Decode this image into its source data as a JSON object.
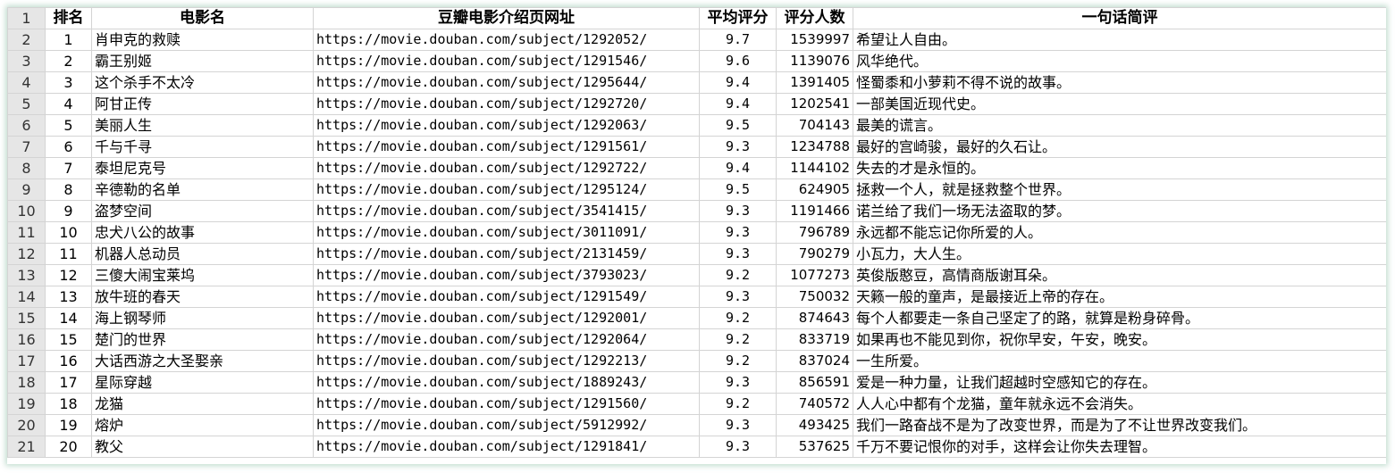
{
  "header": {
    "row_number": "1",
    "rank": "排名",
    "title": "电影名",
    "url": "豆瓣电影介绍页网址",
    "score": "平均评分",
    "count": "评分人数",
    "quote": "一句话简评"
  },
  "rows": [
    {
      "n": "2",
      "rank": "1",
      "title": "肖申克的救赎",
      "url": "https://movie.douban.com/subject/1292052/",
      "score": "9.7",
      "count": "1539997",
      "quote": "希望让人自由。"
    },
    {
      "n": "3",
      "rank": "2",
      "title": "霸王别姬",
      "url": "https://movie.douban.com/subject/1291546/",
      "score": "9.6",
      "count": "1139076",
      "quote": "风华绝代。"
    },
    {
      "n": "4",
      "rank": "3",
      "title": "这个杀手不太冷",
      "url": "https://movie.douban.com/subject/1295644/",
      "score": "9.4",
      "count": "1391405",
      "quote": "怪蜀黍和小萝莉不得不说的故事。"
    },
    {
      "n": "5",
      "rank": "4",
      "title": "阿甘正传",
      "url": "https://movie.douban.com/subject/1292720/",
      "score": "9.4",
      "count": "1202541",
      "quote": "一部美国近现代史。"
    },
    {
      "n": "6",
      "rank": "5",
      "title": "美丽人生",
      "url": "https://movie.douban.com/subject/1292063/",
      "score": "9.5",
      "count": "704143",
      "quote": "最美的谎言。"
    },
    {
      "n": "7",
      "rank": "6",
      "title": "千与千寻",
      "url": "https://movie.douban.com/subject/1291561/",
      "score": "9.3",
      "count": "1234788",
      "quote": "最好的宫崎骏，最好的久石让。"
    },
    {
      "n": "8",
      "rank": "7",
      "title": "泰坦尼克号",
      "url": "https://movie.douban.com/subject/1292722/",
      "score": "9.4",
      "count": "1144102",
      "quote": "失去的才是永恒的。"
    },
    {
      "n": "9",
      "rank": "8",
      "title": "辛德勒的名单",
      "url": "https://movie.douban.com/subject/1295124/",
      "score": "9.5",
      "count": "624905",
      "quote": "拯救一个人，就是拯救整个世界。"
    },
    {
      "n": "10",
      "rank": "9",
      "title": "盗梦空间",
      "url": "https://movie.douban.com/subject/3541415/",
      "score": "9.3",
      "count": "1191466",
      "quote": "诺兰给了我们一场无法盗取的梦。"
    },
    {
      "n": "11",
      "rank": "10",
      "title": "忠犬八公的故事",
      "url": "https://movie.douban.com/subject/3011091/",
      "score": "9.3",
      "count": "796789",
      "quote": "永远都不能忘记你所爱的人。"
    },
    {
      "n": "12",
      "rank": "11",
      "title": "机器人总动员",
      "url": "https://movie.douban.com/subject/2131459/",
      "score": "9.3",
      "count": "790279",
      "quote": "小瓦力，大人生。"
    },
    {
      "n": "13",
      "rank": "12",
      "title": "三傻大闹宝莱坞",
      "url": "https://movie.douban.com/subject/3793023/",
      "score": "9.2",
      "count": "1077273",
      "quote": "英俊版憨豆，高情商版谢耳朵。"
    },
    {
      "n": "14",
      "rank": "13",
      "title": "放牛班的春天",
      "url": "https://movie.douban.com/subject/1291549/",
      "score": "9.3",
      "count": "750032",
      "quote": "天籁一般的童声，是最接近上帝的存在。"
    },
    {
      "n": "15",
      "rank": "14",
      "title": "海上钢琴师",
      "url": "https://movie.douban.com/subject/1292001/",
      "score": "9.2",
      "count": "874643",
      "quote": "每个人都要走一条自己坚定了的路，就算是粉身碎骨。"
    },
    {
      "n": "16",
      "rank": "15",
      "title": "楚门的世界",
      "url": "https://movie.douban.com/subject/1292064/",
      "score": "9.2",
      "count": "833719",
      "quote": "如果再也不能见到你，祝你早安，午安，晚安。"
    },
    {
      "n": "17",
      "rank": "16",
      "title": "大话西游之大圣娶亲",
      "url": "https://movie.douban.com/subject/1292213/",
      "score": "9.2",
      "count": "837024",
      "quote": "一生所爱。"
    },
    {
      "n": "18",
      "rank": "17",
      "title": "星际穿越",
      "url": "https://movie.douban.com/subject/1889243/",
      "score": "9.3",
      "count": "856591",
      "quote": "爱是一种力量，让我们超越时空感知它的存在。"
    },
    {
      "n": "19",
      "rank": "18",
      "title": "龙猫",
      "url": "https://movie.douban.com/subject/1291560/",
      "score": "9.2",
      "count": "740572",
      "quote": "人人心中都有个龙猫，童年就永远不会消失。"
    },
    {
      "n": "20",
      "rank": "19",
      "title": "熔炉",
      "url": "https://movie.douban.com/subject/5912992/",
      "score": "9.3",
      "count": "493425",
      "quote": "我们一路奋战不是为了改变世界，而是为了不让世界改变我们。"
    },
    {
      "n": "21",
      "rank": "20",
      "title": "教父",
      "url": "https://movie.douban.com/subject/1291841/",
      "score": "9.3",
      "count": "537625",
      "quote": "千万不要记恨你的对手，这样会让你失去理智。"
    }
  ]
}
